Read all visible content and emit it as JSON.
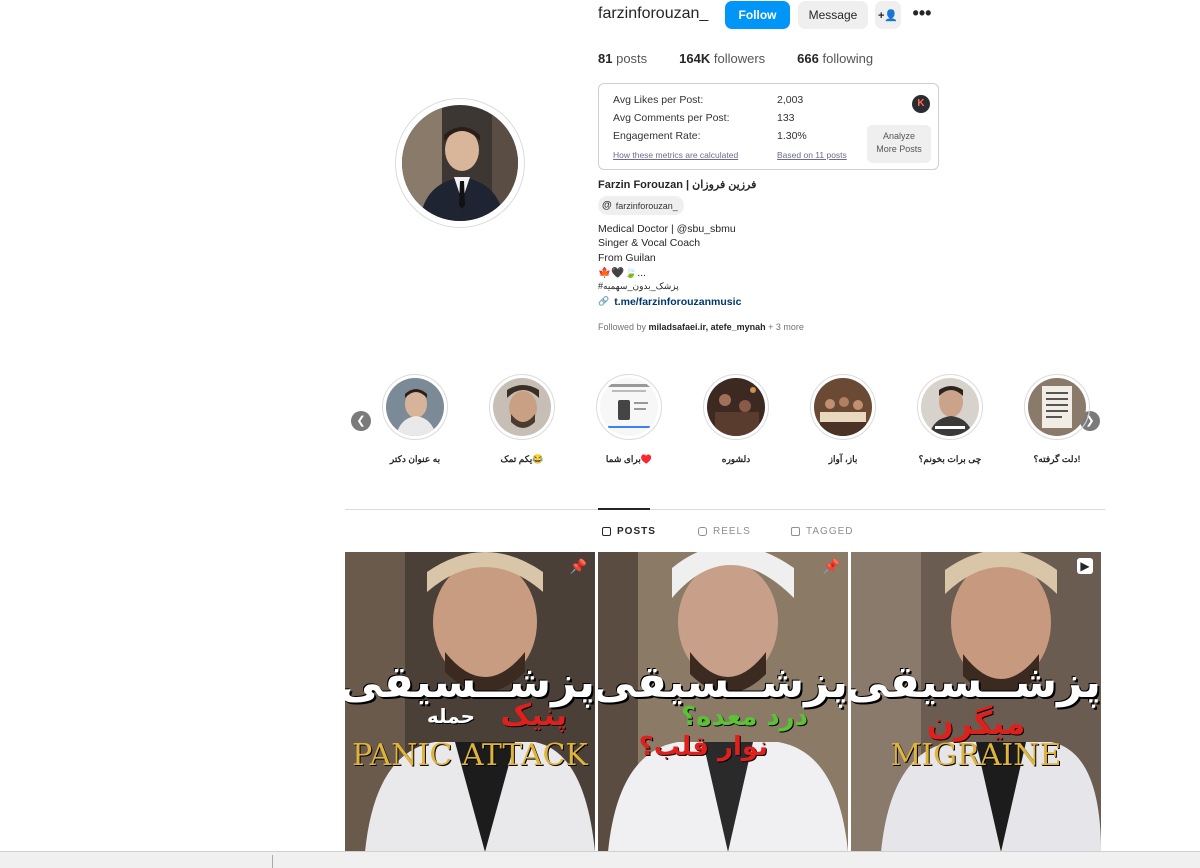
{
  "profile": {
    "username": "farzinforouzan_",
    "follow_label": "Follow",
    "message_label": "Message",
    "adduser_icon": "+👤",
    "more_icon": "•••",
    "stats": {
      "posts_value": "81",
      "posts_label": "posts",
      "followers_value": "164K",
      "followers_label": "followers",
      "following_value": "666",
      "following_label": "following"
    },
    "full_name": "Farzin Forouzan | فرزین فروزان",
    "threads_handle": "farzinforouzan_",
    "threads_icon": "@",
    "bio": {
      "line1": "Medical Doctor | @sbu_sbmu",
      "line2": "Singer & Vocal Coach",
      "line3": "From Guilan",
      "line4": "🍁🖤🍃...",
      "line5": "#پزشک_بدون_سهمیه",
      "link": "t.me/farzinforouzanmusic",
      "link_icon": "🔗"
    },
    "followed_by_prefix": "Followed by ",
    "followed_by_names": "miladsafaei.ir, atefe_mynah",
    "followed_by_more": " + 3 more"
  },
  "metrics": {
    "likes_label": "Avg Likes per Post:",
    "likes_value": "2,003",
    "comments_label": "Avg Comments per Post:",
    "comments_value": "133",
    "engagement_label": "Engagement Rate:",
    "engagement_value": "1.30%",
    "calc_link": "How these metrics are calculated",
    "based_link": "Based on 11 posts",
    "analyze_line1": "Analyze",
    "analyze_line2": "More Posts",
    "badge": "K"
  },
  "highlights": [
    {
      "label": "به عنوان دکتر"
    },
    {
      "label": "یکم تمک😂"
    },
    {
      "label": "برای شما♥️"
    },
    {
      "label": "دلشوره"
    },
    {
      "label": "باز، آواز"
    },
    {
      "label": "چی برات بخونم؟"
    },
    {
      "label": "دلت گرفته؟!"
    }
  ],
  "tabs": {
    "posts": "POSTS",
    "reels": "REELS",
    "tagged": "TAGGED"
  },
  "posts": [
    {
      "title": "پزشــسیقی",
      "sub1": "حمله",
      "sub2": "پنیک",
      "eng": "PANIC ATTACK",
      "pin": "📌"
    },
    {
      "title": "پزشــسیقی",
      "sub1": "درد معده؟",
      "sub2": "نوار قلب؟",
      "eng": "",
      "pin": "📌"
    },
    {
      "title": "پزشــسیقی",
      "sub1": "میگرن",
      "sub2": "",
      "eng": "MIGRAINE",
      "pin": "▶"
    }
  ],
  "colors": {
    "follow_blue": "#0095f6",
    "accent_red": "#e0201c",
    "accent_green": "#5bc236",
    "accent_gold": "#e0b43a"
  }
}
